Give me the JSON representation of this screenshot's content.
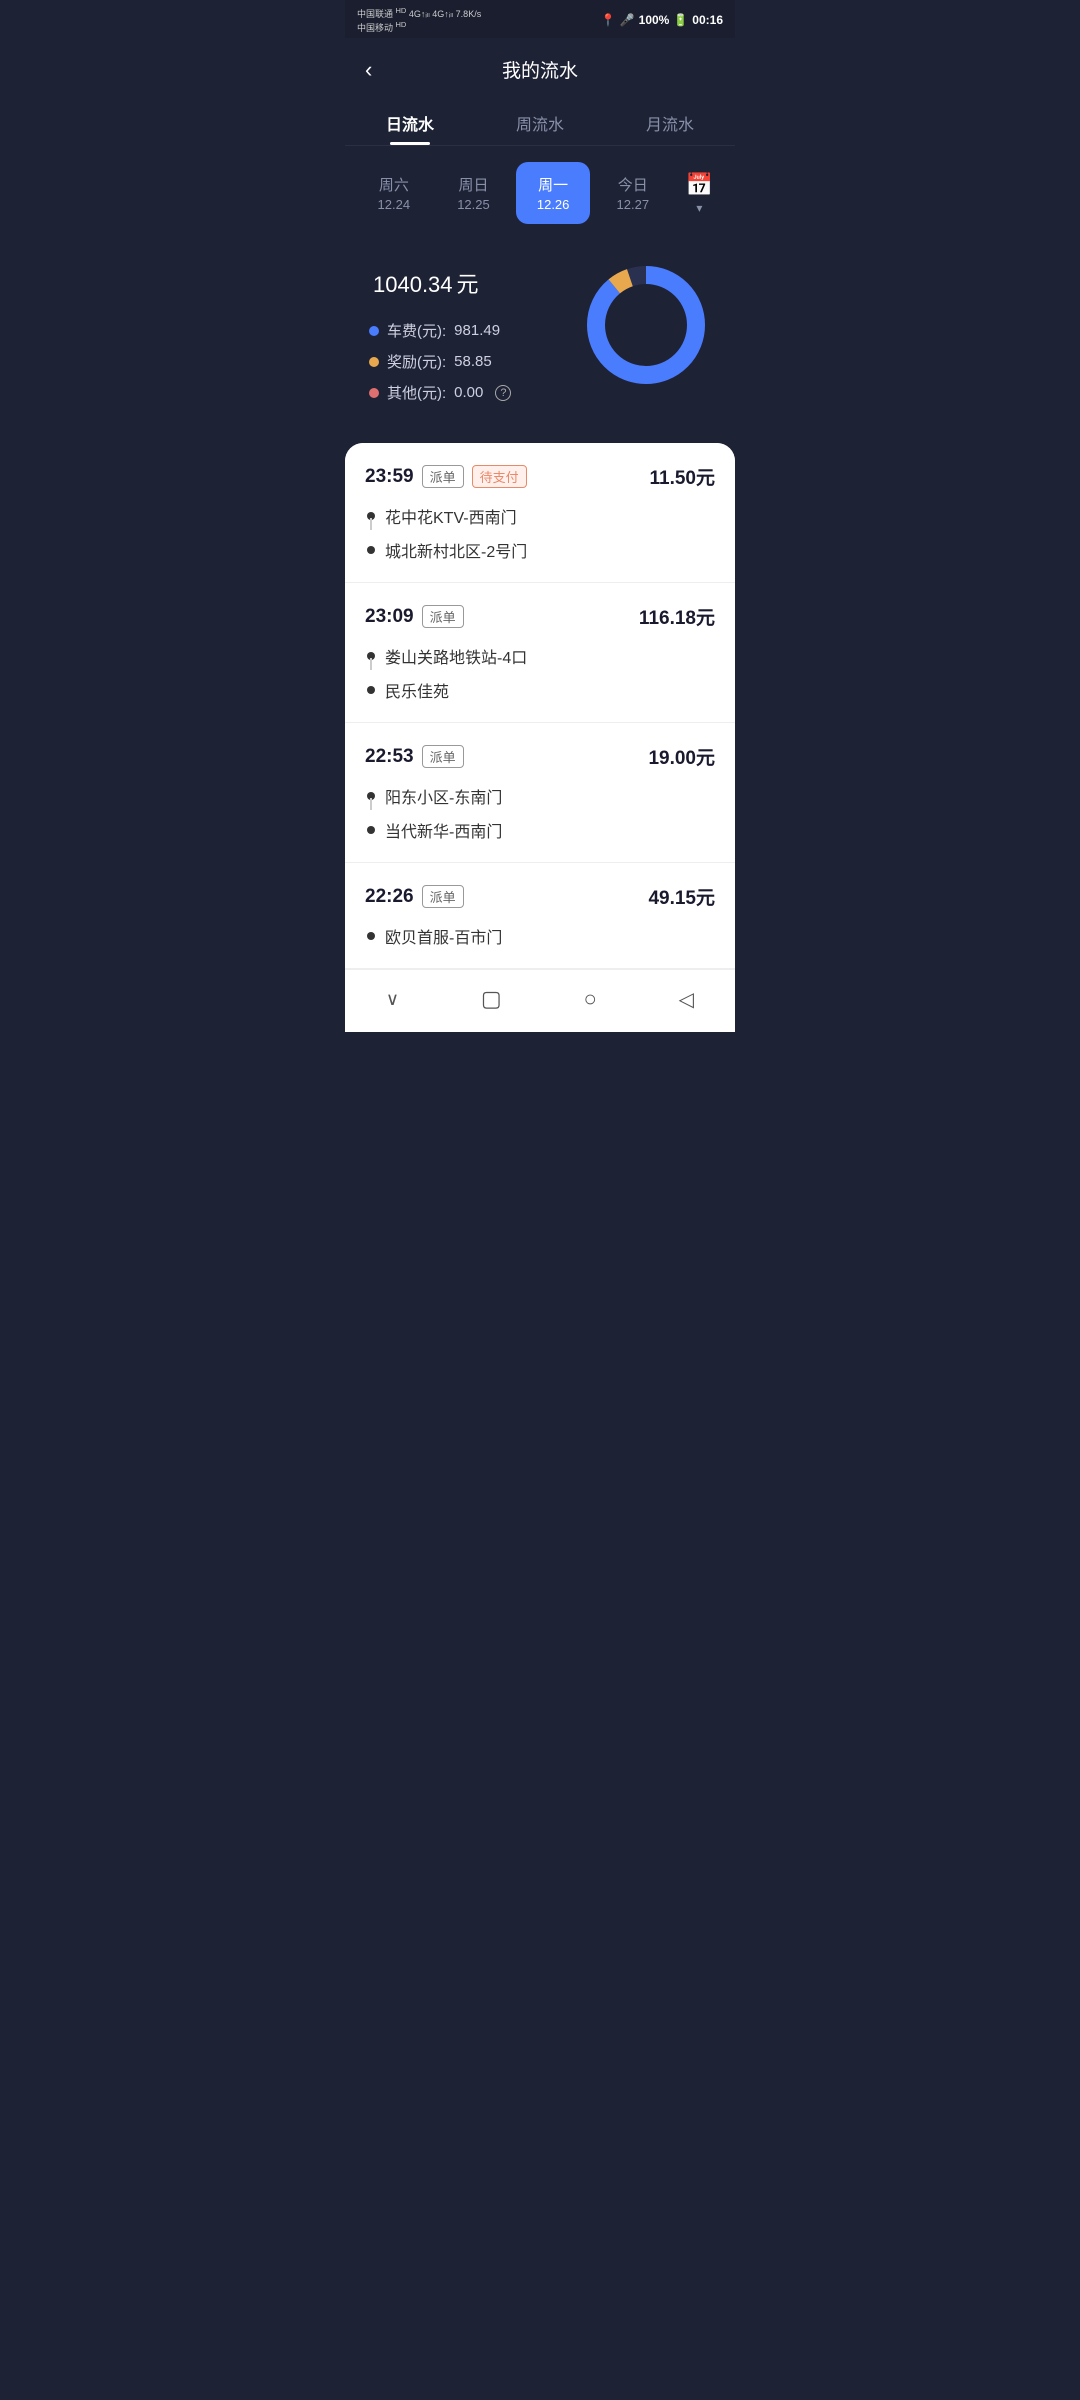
{
  "statusBar": {
    "carrier1": "中国联通",
    "carrier2": "中国移动",
    "hd1": "HD",
    "hd2": "HD",
    "signal": "4G",
    "speed": "7.8 K/s",
    "battery": "100%",
    "time": "00:16"
  },
  "header": {
    "back": "‹",
    "title": "我的流水"
  },
  "tabs": [
    {
      "label": "日流水",
      "active": true
    },
    {
      "label": "周流水",
      "active": false
    },
    {
      "label": "月流水",
      "active": false
    }
  ],
  "days": [
    {
      "name": "周六",
      "date": "12.24",
      "active": false
    },
    {
      "name": "周日",
      "date": "12.25",
      "active": false
    },
    {
      "name": "周一",
      "date": "12.26",
      "active": true
    },
    {
      "name": "今日",
      "date": "12.27",
      "active": false
    }
  ],
  "stats": {
    "total": "1040.34",
    "unit": "元",
    "rows": [
      {
        "label": "车费(元):",
        "value": "981.49",
        "dotClass": "dot-blue"
      },
      {
        "label": "奖励(元):",
        "value": "58.85",
        "dotClass": "dot-gold"
      },
      {
        "label": "其他(元):",
        "value": "0.00",
        "dotClass": "dot-red",
        "hasInfo": true
      }
    ],
    "chart": {
      "bluePercent": 94.3,
      "goldPercent": 5.7
    }
  },
  "orders": [
    {
      "time": "23:59",
      "tags": [
        "派单",
        "待支付"
      ],
      "amount": "11.50元",
      "from": "花中花KTV-西南门",
      "to": "城北新村北区-2号门"
    },
    {
      "time": "23:09",
      "tags": [
        "派单"
      ],
      "amount": "116.18元",
      "from": "娄山关路地铁站-4口",
      "to": "民乐佳苑"
    },
    {
      "time": "22:53",
      "tags": [
        "派单"
      ],
      "amount": "19.00元",
      "from": "阳东小区-东南门",
      "to": "当代新华-西南门"
    },
    {
      "time": "22:26",
      "tags": [
        "派单"
      ],
      "amount": "49.15元",
      "from": "欧贝首服-百市门",
      "to": ""
    }
  ],
  "bottomNav": {
    "down": "∨",
    "square": "□",
    "circle": "○",
    "back": "◁"
  }
}
